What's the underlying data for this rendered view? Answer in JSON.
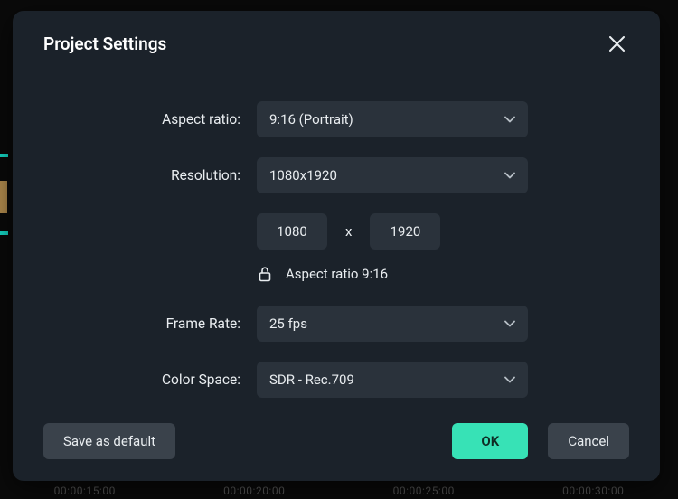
{
  "modal": {
    "title": "Project Settings"
  },
  "labels": {
    "aspect_ratio": "Aspect ratio:",
    "resolution": "Resolution:",
    "frame_rate": "Frame Rate:",
    "color_space": "Color Space:"
  },
  "values": {
    "aspect_ratio_selected": "9:16 (Portrait)",
    "resolution_selected": "1080x1920",
    "width": "1080",
    "dim_separator": "x",
    "height": "1920",
    "lock_text": "Aspect ratio 9:16",
    "frame_rate_selected": "25 fps",
    "color_space_selected": "SDR - Rec.709"
  },
  "buttons": {
    "save_default": "Save as default",
    "ok": "OK",
    "cancel": "Cancel"
  },
  "background": {
    "timeline": [
      "00:00:15:00",
      "00:00:20:00",
      "00:00:25:00",
      "00:00:30:00"
    ]
  }
}
